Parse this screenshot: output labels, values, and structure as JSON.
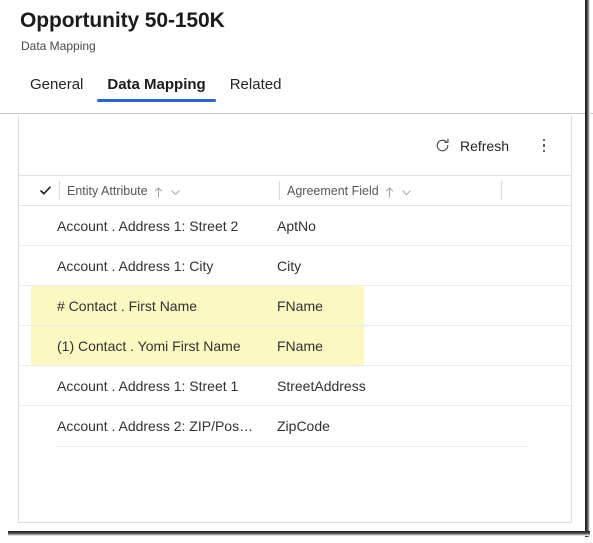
{
  "header": {
    "title": "Opportunity 50-150K",
    "subtitle": "Data Mapping"
  },
  "tabs": [
    {
      "label": "General",
      "selected": false
    },
    {
      "label": "Data Mapping",
      "selected": true
    },
    {
      "label": "Related",
      "selected": false
    }
  ],
  "command_bar": {
    "refresh_label": "Refresh",
    "refresh_icon": "refresh-icon",
    "overflow_icon": "more-vertical-icon"
  },
  "grid": {
    "select_all_icon": "checkmark-icon",
    "columns": [
      {
        "label": "Entity Attribute",
        "sort_icon": "sort-ascending-icon",
        "menu_icon": "chevron-down-icon"
      },
      {
        "label": "Agreement Field",
        "sort_icon": "sort-ascending-icon",
        "menu_icon": "chevron-down-icon"
      }
    ],
    "rows": [
      {
        "entity_attribute": "Account . Address 1: Street 2",
        "agreement_field": "AptNo",
        "highlighted": false
      },
      {
        "entity_attribute": "Account . Address 1: City",
        "agreement_field": "City",
        "highlighted": false
      },
      {
        "entity_attribute": "# Contact . First Name",
        "agreement_field": "FName",
        "highlighted": true
      },
      {
        "entity_attribute": "(1) Contact . Yomi First Name",
        "agreement_field": "FName",
        "highlighted": true
      },
      {
        "entity_attribute": "Account . Address 1: Street 1",
        "agreement_field": "StreetAddress",
        "highlighted": false
      },
      {
        "entity_attribute": "Account . Address 2: ZIP/Pos…",
        "agreement_field": "ZipCode",
        "highlighted": false
      }
    ]
  },
  "colors": {
    "accent": "#2b68c4",
    "highlight": "#fcf8c2",
    "text": "#313131",
    "muted": "#585858"
  }
}
